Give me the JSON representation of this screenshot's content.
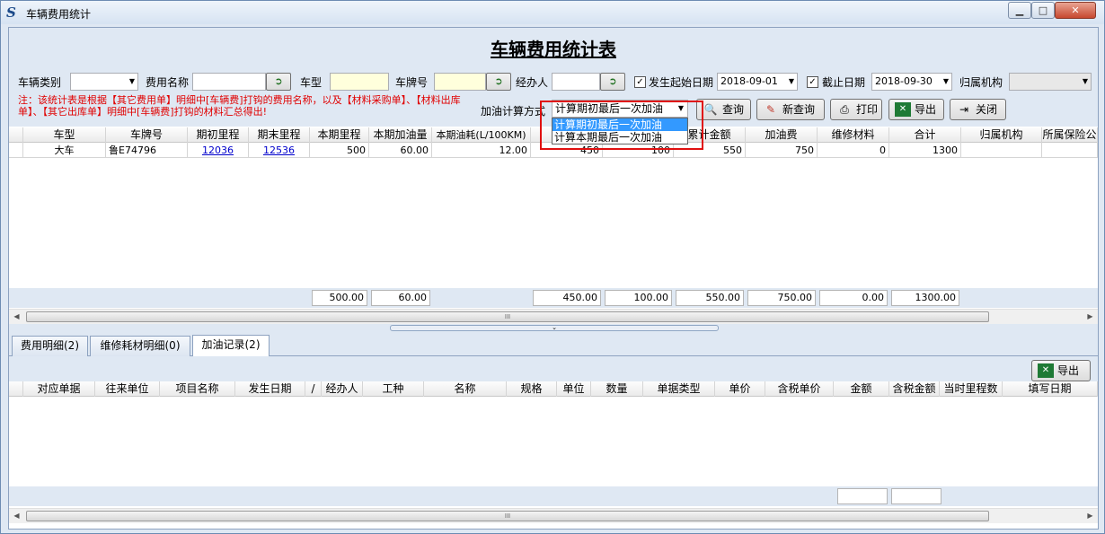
{
  "window": {
    "title": "车辆费用统计",
    "icon": "S",
    "buttons": {
      "minimize": "▁",
      "maximize": "□",
      "close": "✕"
    }
  },
  "report": {
    "title": "车辆费用统计表"
  },
  "filters": {
    "vehicle_category_label": "车辆类别",
    "expense_name_label": "费用名称",
    "vehicle_type_label": "车型",
    "plate_label": "车牌号",
    "handler_label": "经办人",
    "start_date_label": "发生起始日期",
    "start_date_value": "2018-09-01",
    "end_date_label": "截止日期",
    "end_date_value": "2018-09-30",
    "org_label": "归属机构",
    "note": "注：该统计表是根据【其它费用单】明细中[车辆费]打钩的费用名称，以及【材料采购单】、【材料出库单】、【其它出库单】明细中[车辆费]打钩的材料汇总得出!",
    "fuel_method_label": "加油计算方式",
    "fuel_method_value": "计算期初最后一次加油",
    "fuel_method_options": [
      "计算期初最后一次加油",
      "计算本期最后一次加油"
    ]
  },
  "toolbar": {
    "query": "查询",
    "new_query": "新查询",
    "print": "打印",
    "export": "导出",
    "close": "关闭"
  },
  "grid": {
    "columns": [
      "车型",
      "车牌号",
      "期初里程",
      "期末里程",
      "本期里程",
      "本期加油量",
      "本期油耗(L/100KM)",
      "车辆",
      "",
      "累计金额",
      "加油费",
      "维修材料",
      "合计",
      "归属机构",
      "所属保险公"
    ],
    "rows": [
      {
        "type": "大车",
        "plate": "鲁E74796",
        "start_km": "12036",
        "end_km": "12536",
        "period_km": "500",
        "fuel": "60.00",
        "consumption": "12.00",
        "c8": "450",
        "c9": "100",
        "total_amount": "550",
        "fuel_fee": "750",
        "repair": "0",
        "sum": "1300",
        "org": "",
        "insurer": ""
      }
    ],
    "totals": {
      "period_km": "500.00",
      "fuel": "60.00",
      "c8": "450.00",
      "c9": "100.00",
      "total_amount": "550.00",
      "fuel_fee": "750.00",
      "repair": "0.00",
      "sum": "1300.00"
    }
  },
  "tabs": [
    {
      "label": "费用明细(2)"
    },
    {
      "label": "维修耗材明细(0)"
    },
    {
      "label": "加油记录(2)"
    }
  ],
  "lower": {
    "export": "导出",
    "columns": [
      "对应单据",
      "往来单位",
      "项目名称",
      "发生日期",
      "/",
      "经办人",
      "工种",
      "名称",
      "规格",
      "单位",
      "数量",
      "单据类型",
      "单价",
      "含税单价",
      "金额",
      "含税金额",
      "当时里程数",
      "填写日期"
    ]
  }
}
